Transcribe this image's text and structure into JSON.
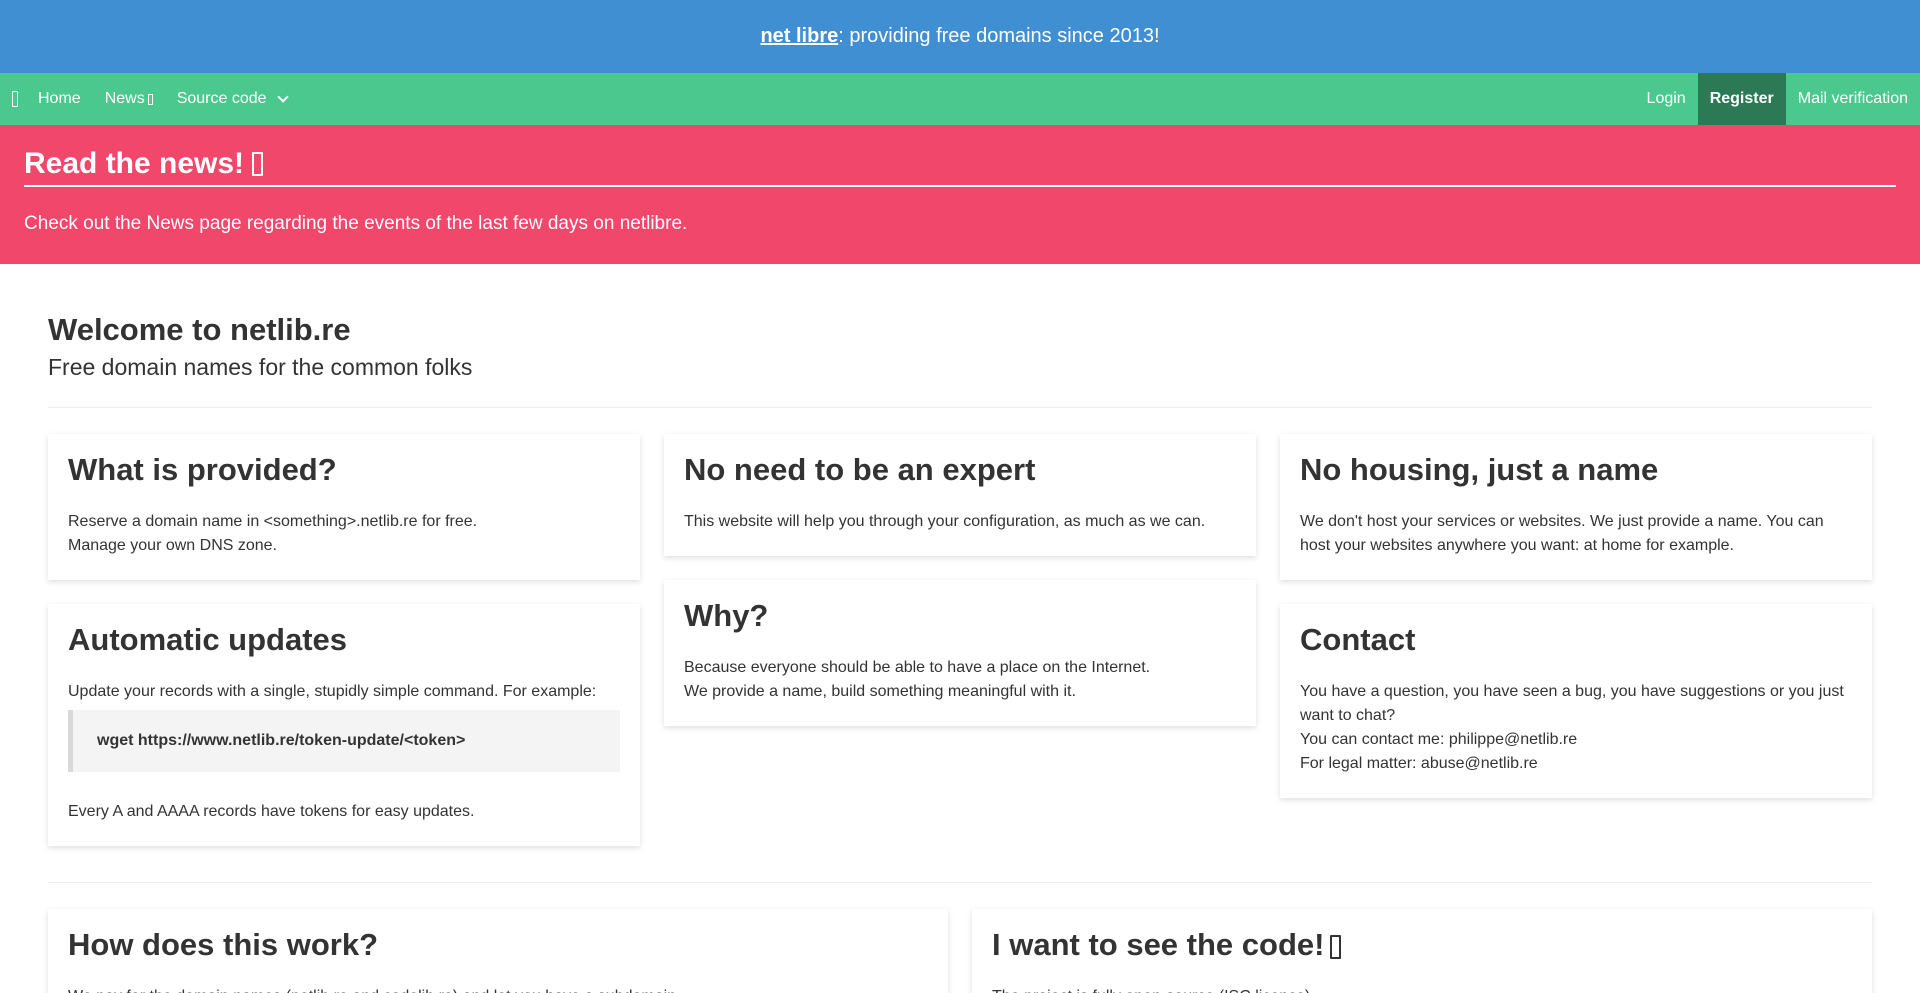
{
  "topbar": {
    "brand": "net libre",
    "tagline": ": providing free domains since 2013!"
  },
  "nav": {
    "menu_icon": "book-icon",
    "left": [
      {
        "label": "Home"
      },
      {
        "label": "News"
      },
      {
        "label": "Source code"
      }
    ],
    "right": [
      {
        "label": "Login"
      },
      {
        "label": "Register"
      },
      {
        "label": "Mail verification"
      }
    ]
  },
  "banner": {
    "title": "Read the news!",
    "text": "Check out the News page regarding the events of the last few days on netlibre."
  },
  "welcome": {
    "title": "Welcome to netlib.re",
    "subtitle": "Free domain names for the common folks"
  },
  "cards": {
    "provided": {
      "title": "What is provided?",
      "line1": "Reserve a domain name in <something>.netlib.re for free.",
      "line2": "Manage your own DNS zone."
    },
    "expert": {
      "title": "No need to be an expert",
      "line1": "This website will help you through your configuration, as much as we can."
    },
    "housing": {
      "title": "No housing, just a name",
      "line1": "We don't host your services or websites. We just provide a name. You can host your websites anywhere you want: at home for example."
    },
    "updates": {
      "title": "Automatic updates",
      "line1": "Update your records with a single, stupidly simple command. For example:",
      "code": "wget https://www.netlib.re/token-update/<token>",
      "line2": "Every A and AAAA records have tokens for easy updates."
    },
    "why": {
      "title": "Why?",
      "line1": "Because everyone should be able to have a place on the Internet.",
      "line2": "We provide a name, build something meaningful with it."
    },
    "contact": {
      "title": "Contact",
      "line1": "You have a question, you have seen a bug, you have suggestions or you just want to chat?",
      "line2": "You can contact me: philippe@netlib.re",
      "line3": "For legal matter: abuse@netlib.re"
    },
    "how": {
      "title": "How does this work?",
      "line1": "We pay for the domain names (netlib.re and codelib.re) and let you have a subdomain."
    },
    "code": {
      "title": "I want to see the code!",
      "line1": "The project is fully open-source (ISC licence)."
    }
  },
  "colors": {
    "topbar": "#408fd3",
    "navbar": "#4ac88e",
    "active": "#2b7955",
    "banner": "#f0476b"
  }
}
